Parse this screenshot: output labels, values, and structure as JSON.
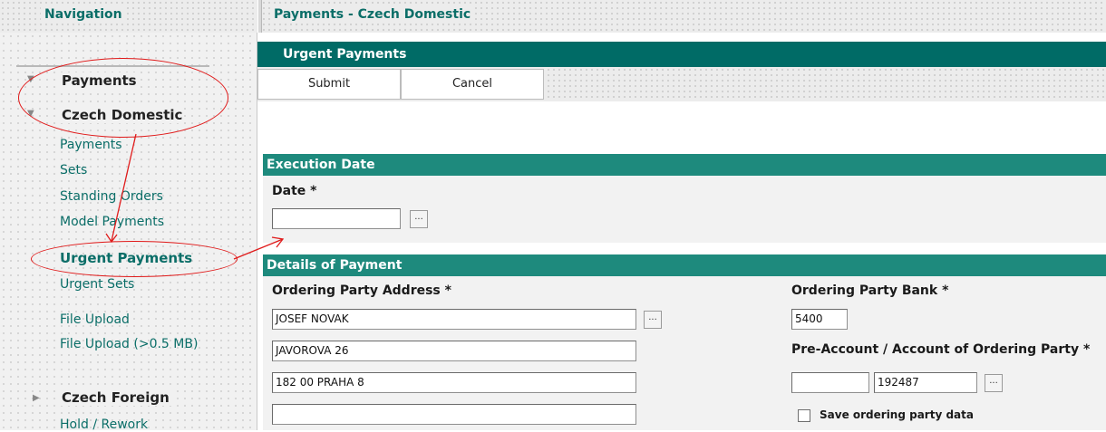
{
  "header": {
    "nav_title": "Navigation",
    "main_title": "Payments - Czech Domestic"
  },
  "sidebar": {
    "group_payments": "Payments",
    "group_czech_domestic": "Czech Domestic",
    "items": [
      "Payments",
      "Sets",
      "Standing Orders",
      "Model Payments",
      "Urgent Payments",
      "Urgent Sets",
      "File Upload",
      "File Upload (>0.5 MB)"
    ],
    "group_czech_foreign": "Czech Foreign",
    "last_item": "Hold / Rework"
  },
  "main": {
    "title": "Urgent Payments",
    "buttons": {
      "submit": "Submit",
      "cancel": "Cancel"
    },
    "execution_section": "Execution Date",
    "date_label": "Date *",
    "date_value": "",
    "details_section": "Details of Payment",
    "ordering_address_label": "Ordering Party Address  *",
    "address_lines": [
      "JOSEF NOVAK",
      "JAVOROVA 26",
      "182 00 PRAHA 8",
      ""
    ],
    "ordering_bank_label": "Ordering Party Bank *",
    "ordering_bank_value": "5400",
    "account_label": "Pre-Account / Account of Ordering Party *",
    "pre_account_value": "",
    "account_value": "192487",
    "save_data_label": "Save ordering party data",
    "ellipsis": "..."
  },
  "colors": {
    "teal_dark": "#006b66",
    "teal": "#1e8a7d",
    "annotation_red": "#e01a1a"
  }
}
